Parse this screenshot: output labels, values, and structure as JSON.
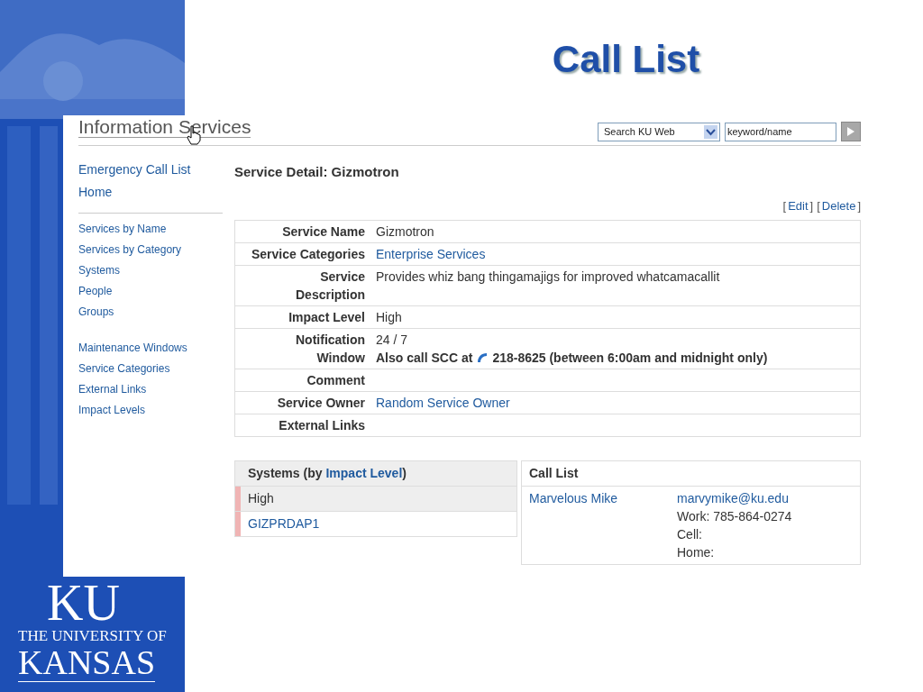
{
  "slide": {
    "title": "Call List",
    "logo": {
      "mark": "KU",
      "line_1": "THE UNIVERSITY OF",
      "line_2": "KANSAS"
    }
  },
  "header": {
    "title": "Information Services",
    "search_scope": "Search KU Web",
    "search": {
      "value": "keyword/name"
    }
  },
  "sidebar": {
    "groups": [
      {
        "items": [
          {
            "label": "Emergency Call List"
          },
          {
            "label": "Home"
          }
        ]
      },
      {
        "items": [
          {
            "label": "Services by Name"
          },
          {
            "label": "Services by Category"
          },
          {
            "label": "Systems"
          },
          {
            "label": "People"
          },
          {
            "label": "Groups"
          }
        ]
      },
      {
        "items": [
          {
            "label": "Maintenance Windows"
          },
          {
            "label": "Service Categories"
          },
          {
            "label": "External Links"
          },
          {
            "label": "Impact Levels"
          }
        ]
      }
    ]
  },
  "detail": {
    "heading": "Service Detail: Gizmotron",
    "actions": [
      {
        "open": "[",
        "label": "Edit",
        "close": "]"
      },
      {
        "open": "[",
        "label": "Delete",
        "close": "]"
      }
    ],
    "fields": [
      {
        "label_lines": [
          "Service Name"
        ],
        "kind": "text",
        "value": "Gizmotron"
      },
      {
        "label_lines": [
          "Service Categories"
        ],
        "kind": "link",
        "value": "Enterprise Services"
      },
      {
        "label_lines": [
          "Service",
          "Description"
        ],
        "kind": "text",
        "value": "Provides whiz bang thingamajigs for improved whatcamacallit"
      },
      {
        "label_lines": [
          "Impact Level"
        ],
        "kind": "text",
        "value": "High"
      },
      {
        "label_lines": [
          "Notification",
          "Window"
        ],
        "kind": "notification",
        "value": "24 / 7",
        "note": "Also call SCC at",
        "phone": "218-8625 (between 6:00am and midnight only)"
      },
      {
        "label_lines": [
          "Comment"
        ],
        "kind": "empty"
      },
      {
        "label_lines": [
          "Service Owner"
        ],
        "kind": "link",
        "value": "Random Service Owner"
      },
      {
        "label_lines": [
          "External Links"
        ],
        "kind": "empty"
      }
    ]
  },
  "systems": {
    "title_before": "Systems (by",
    "title_link": "Impact Level",
    "title_after": ")",
    "rows": [
      {
        "kind": "group",
        "label": "High",
        "color": "#f0b4b4"
      },
      {
        "kind": "system",
        "label": "GIZPRDAP1",
        "color": "#f0b4b4"
      }
    ]
  },
  "call_list": {
    "title": "Call List",
    "contacts": [
      {
        "name": "Marvelous Mike",
        "email": "marvymike@ku.edu",
        "lines": [
          "Work: 785-864-0274",
          "Cell:",
          "Home:"
        ]
      }
    ]
  }
}
